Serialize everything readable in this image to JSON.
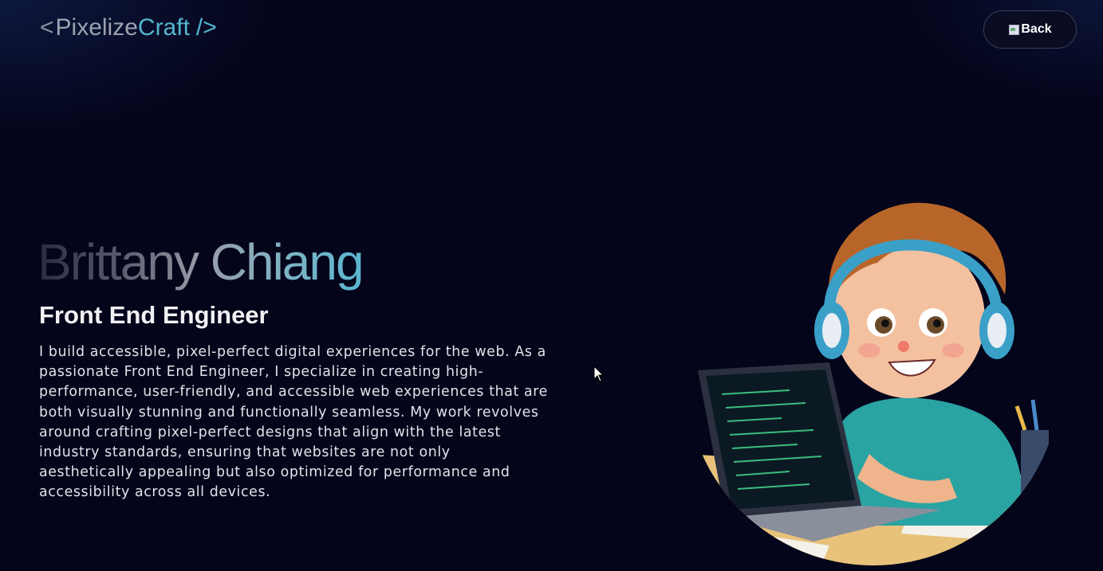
{
  "header": {
    "logo_lt": "<",
    "logo_pix": "Pixelize",
    "logo_craft": "Craft",
    "logo_close": "/>",
    "back_label": "Back"
  },
  "hero": {
    "name": "Brittany Chiang",
    "role": "Front End Engineer",
    "bio": "I build accessible, pixel-perfect digital experiences for the web. As a passionate Front End Engineer, I specialize in creating high-performance, user-friendly, and accessible web experiences that are both visually stunning and functionally seamless. My work revolves around crafting pixel-perfect designs that align with the latest industry standards, ensuring that websites are not only aesthetically appealing but also optimized for performance and accessibility across all devices."
  },
  "colors": {
    "background": "#04041a",
    "accent": "#55b6cf",
    "button_border": "#3a3f55"
  },
  "icons": {
    "back": "broken-image-icon",
    "portrait": "illustration-boy-with-headphones-laptop"
  }
}
